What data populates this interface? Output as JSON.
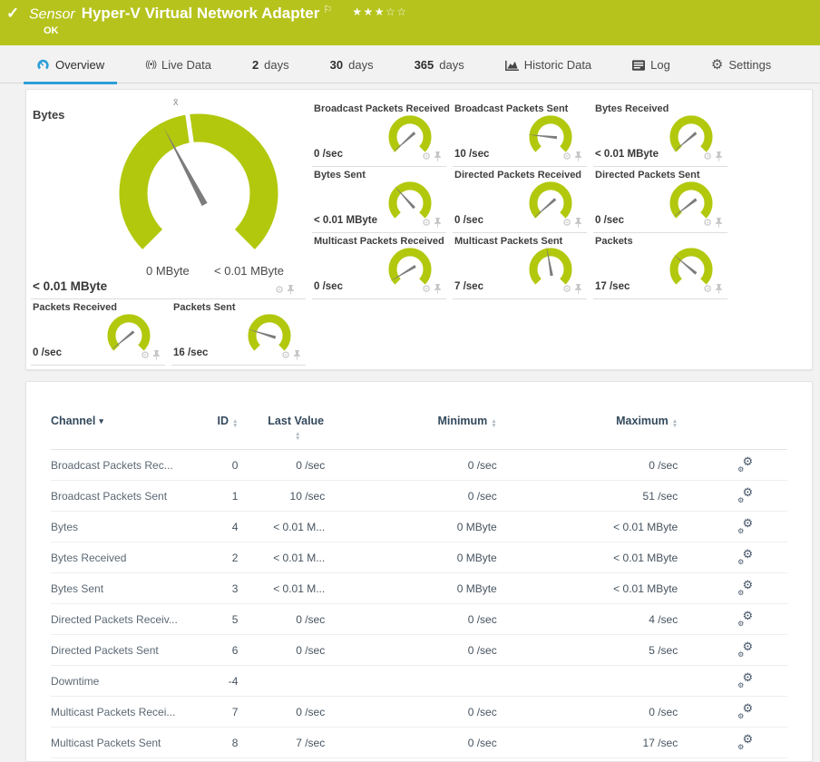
{
  "header": {
    "sensor_label": "Sensor",
    "title": "Hyper-V Virtual Network Adapter",
    "status": "OK",
    "stars_filled": 3,
    "stars_total": 5
  },
  "icons": {
    "check": "✓",
    "flag": "⚐",
    "star_filled": "★",
    "star_empty": "☆",
    "gear": "⚙",
    "caret_down": "▾",
    "sort_up": "▲",
    "sort_down": "▼",
    "live_glyph": "((•))"
  },
  "colors": {
    "header_bg": "#b6c31d",
    "accent_blue": "#2d9fd8",
    "gauge_green": "#b2c80d",
    "needle_gray": "#7c7c7c"
  },
  "tabs": [
    {
      "label": "Overview",
      "icon": "overview",
      "active": true
    },
    {
      "label": "Live Data",
      "icon": "live"
    },
    {
      "num": "2",
      "label": "days"
    },
    {
      "num": "30",
      "label": "days"
    },
    {
      "num": "365",
      "label": "days"
    },
    {
      "label": "Historic Data",
      "icon": "historic"
    },
    {
      "label": "Log",
      "icon": "log"
    },
    {
      "label": "Settings",
      "icon": "settings"
    }
  ],
  "gauges": {
    "main": {
      "title": "Bytes",
      "value": "< 0.01 MByte",
      "scale_min": "0 MByte",
      "scale_max": "< 0.01 MByte",
      "avg_label": "x̄",
      "needle_angle": 118,
      "marker_angle": 98
    },
    "small": [
      {
        "title": "Broadcast Packets Received",
        "value": "0 /sec",
        "angle": 222
      },
      {
        "title": "Broadcast Packets Sent",
        "value": "10 /sec",
        "angle": 174
      },
      {
        "title": "Bytes Received",
        "value": "< 0.01 MByte",
        "angle": 220
      },
      {
        "title": "Bytes Sent",
        "value": "< 0.01 MByte",
        "angle": 132
      },
      {
        "title": "Directed Packets Received",
        "value": "0 /sec",
        "angle": 221
      },
      {
        "title": "Directed Packets Sent",
        "value": "0 /sec",
        "angle": 218
      },
      {
        "title": "Multicast Packets Received",
        "value": "0 /sec",
        "angle": 211
      },
      {
        "title": "Multicast Packets Sent",
        "value": "7 /sec",
        "angle": 100
      },
      {
        "title": "Packets",
        "value": "17 /sec",
        "angle": 140
      },
      {
        "title": "Packets Received",
        "value": "0 /sec",
        "angle": 219
      },
      {
        "title": "Packets Sent",
        "value": "16 /sec",
        "angle": 163
      }
    ]
  },
  "table": {
    "columns": {
      "channel": "Channel",
      "id": "ID",
      "last": "Last Value",
      "min": "Minimum",
      "max": "Maximum"
    },
    "rows": [
      {
        "channel": "Broadcast Packets Rec...",
        "id": "0",
        "last": "0 /sec",
        "min": "0 /sec",
        "max": "0 /sec"
      },
      {
        "channel": "Broadcast Packets Sent",
        "id": "1",
        "last": "10 /sec",
        "min": "0 /sec",
        "max": "51 /sec"
      },
      {
        "channel": "Bytes",
        "id": "4",
        "last": "< 0.01 M...",
        "min": "0 MByte",
        "max": "< 0.01 MByte"
      },
      {
        "channel": "Bytes Received",
        "id": "2",
        "last": "< 0.01 M...",
        "min": "0 MByte",
        "max": "< 0.01 MByte"
      },
      {
        "channel": "Bytes Sent",
        "id": "3",
        "last": "< 0.01 M...",
        "min": "0 MByte",
        "max": "< 0.01 MByte"
      },
      {
        "channel": "Directed Packets Receiv...",
        "id": "5",
        "last": "0 /sec",
        "min": "0 /sec",
        "max": "4 /sec"
      },
      {
        "channel": "Directed Packets Sent",
        "id": "6",
        "last": "0 /sec",
        "min": "0 /sec",
        "max": "5 /sec"
      },
      {
        "channel": "Downtime",
        "id": "-4",
        "last": "",
        "min": "",
        "max": ""
      },
      {
        "channel": "Multicast Packets Recei...",
        "id": "7",
        "last": "0 /sec",
        "min": "0 /sec",
        "max": "0 /sec"
      },
      {
        "channel": "Multicast Packets Sent",
        "id": "8",
        "last": "7 /sec",
        "min": "0 /sec",
        "max": "17 /sec"
      }
    ]
  }
}
